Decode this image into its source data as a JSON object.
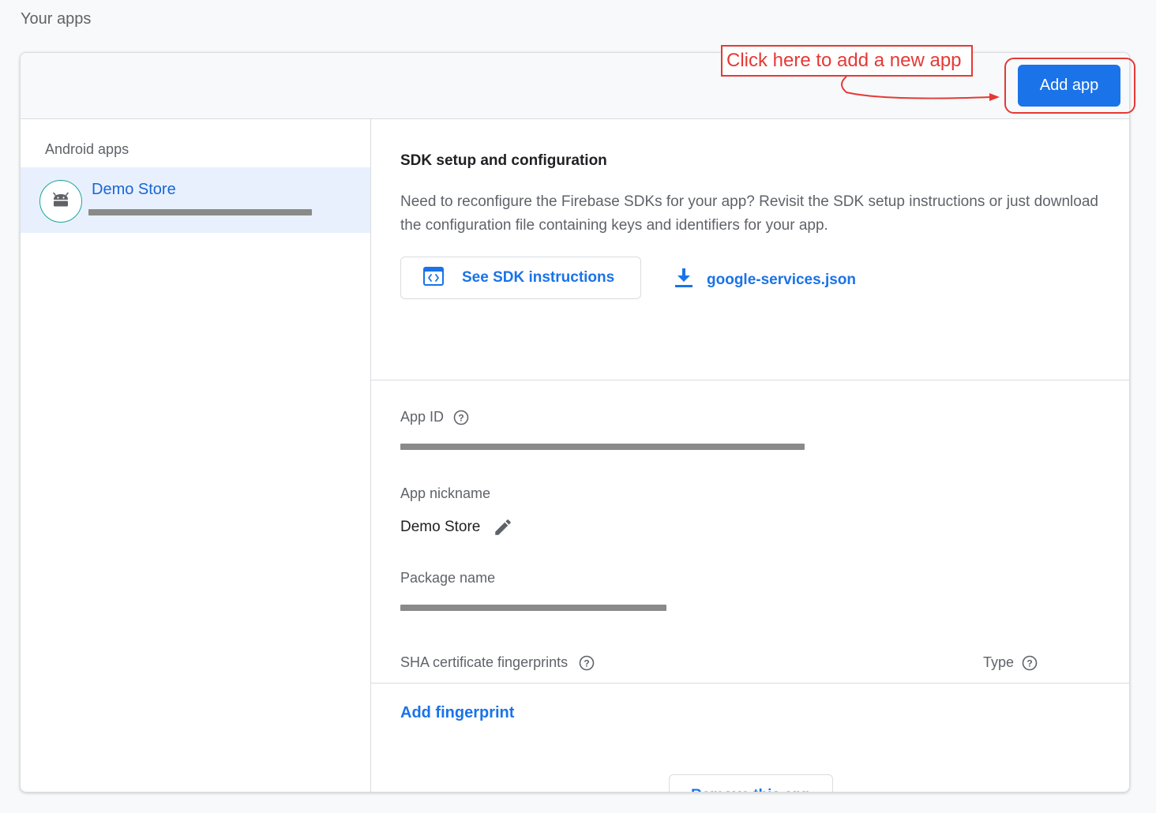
{
  "page": {
    "heading": "Your apps"
  },
  "header": {
    "add_app_label": "Add app"
  },
  "annotation": {
    "text": "Click here to add a new app",
    "color": "#e53935"
  },
  "sidebar": {
    "section_label": "Android apps",
    "items": [
      {
        "name": "Demo Store",
        "icon": "android-icon",
        "selected": true
      }
    ]
  },
  "sdk": {
    "title": "SDK setup and configuration",
    "description": "Need to reconfigure the Firebase SDKs for your app? Revisit the SDK setup instructions or just download the configuration file containing keys and identifiers for your app.",
    "instructions_label": "See SDK instructions",
    "config_file_label": "google-services.json"
  },
  "details": {
    "app_id_label": "App ID",
    "app_nickname_label": "App nickname",
    "app_nickname_value": "Demo Store",
    "package_name_label": "Package name",
    "sha_label": "SHA certificate fingerprints",
    "type_label": "Type",
    "add_fingerprint_label": "Add fingerprint",
    "remove_label": "Remove this app"
  },
  "colors": {
    "accent": "#1a73e8",
    "selected_bg": "#e8f0fe",
    "avatar_ring": "#1ea597"
  }
}
